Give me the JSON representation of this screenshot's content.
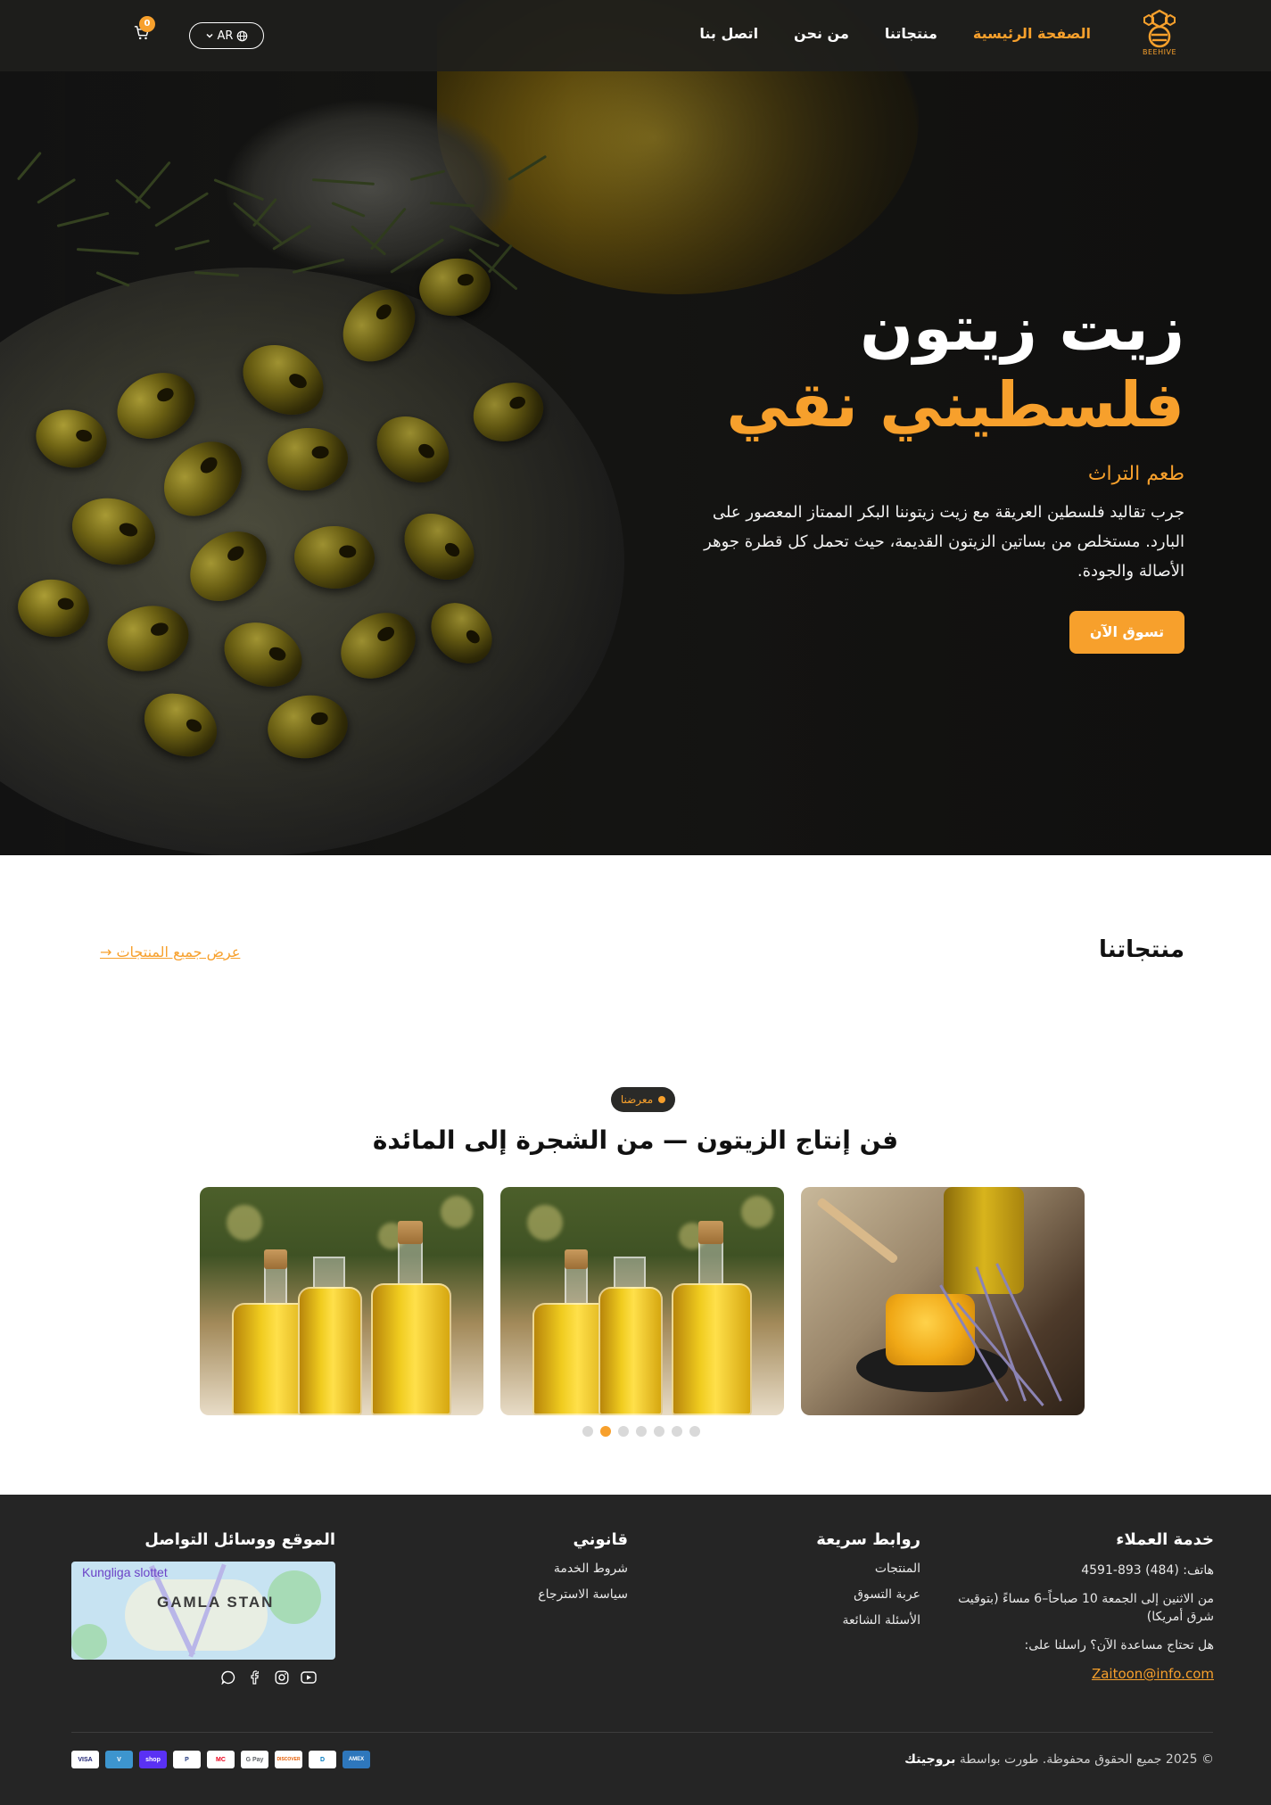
{
  "header": {
    "logo_text": "BEEHIVE",
    "nav": [
      {
        "label": "الصفحة الرئيسية",
        "active": true
      },
      {
        "label": "منتجاتنا",
        "active": false
      },
      {
        "label": "من نحن",
        "active": false
      },
      {
        "label": "اتصل بنا",
        "active": false
      }
    ],
    "language": "AR",
    "cart_count": "0"
  },
  "hero": {
    "title_line1": "زيت زيتون",
    "title_line2": "فلسطيني نقي",
    "tagline": "طعم التراث",
    "description": "جرب تقاليد فلسطين العريقة مع زيت زيتوننا البكر الممتاز المعصور على البارد. مستخلص من بساتين الزيتون القديمة، حيث تحمل كل قطرة جوهر الأصالة والجودة.",
    "cta": "تسوق الآن"
  },
  "products": {
    "title": "منتجاتنا",
    "view_all": "عرض جميع المنتجات →"
  },
  "gallery": {
    "badge": "معرضنا",
    "title": "فن إنتاج الزيتون — من الشجرة إلى المائدة",
    "slides": 7,
    "active_slide": 2
  },
  "footer": {
    "service": {
      "title": "خدمة العملاء",
      "phone": "هاتف: (484) 893-4591",
      "hours": "من الاثنين إلى الجمعة 10 صباحاً–6 مساءً (بتوقيت شرق أمريكا)",
      "help": "هل تحتاج مساعدة الآن؟ راسلنا على:",
      "email": "Zaitoon@info.com"
    },
    "quick_links": {
      "title": "روابط سريعة",
      "items": [
        "المنتجات",
        "عربة التسوق",
        "الأسئلة الشائعة"
      ]
    },
    "legal": {
      "title": "قانوني",
      "items": [
        "شروط الخدمة",
        "سياسة الاسترجاع"
      ]
    },
    "location": {
      "title": "الموقع ووسائل التواصل",
      "map_label": "GAMLA STAN",
      "map_poi": "Kungliga slottet"
    },
    "copyright_prefix": "© 2025 جميع الحقوق محفوظة. طورت بواسطة",
    "copyright_brand": "بروجيتك",
    "payments": [
      "VISA",
      "V",
      "shop",
      "P",
      "MC",
      "G Pay",
      "DISCOVER",
      "D",
      "AMEX"
    ]
  },
  "colors": {
    "accent": "#f7a02c",
    "header_bg": "#1e1e1c",
    "footer_bg": "#252525"
  }
}
